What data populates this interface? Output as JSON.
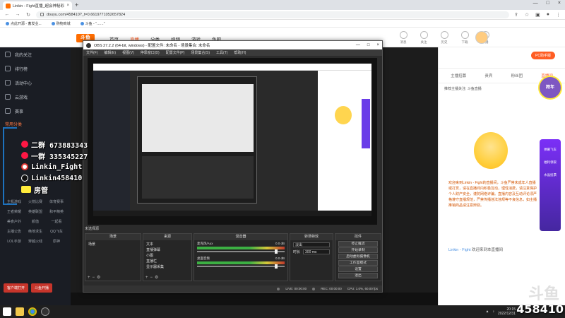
{
  "browser": {
    "tab_title": "Linkin - Fight直播_超会神秘彩三...",
    "tab_close": "×",
    "new_tab": "+",
    "url": "douyu.com/458410?_t=0.6619771052657824",
    "window_controls": [
      "—",
      "□",
      "×"
    ],
    "bookmarks": [
      "点此开源 - 蓄发业...",
      "购物商城",
      "斗鱼 - “……”"
    ]
  },
  "site": {
    "logo": "斗鱼",
    "nav": [
      "首页",
      "直播",
      "分类",
      "视频",
      "游戏",
      "鱼吧"
    ],
    "active_nav": "直播",
    "top_icons": [
      "消息",
      "关注",
      "历史",
      "下载",
      "开播"
    ],
    "pc_badge": "PC助手版"
  },
  "sidebar": {
    "items": [
      {
        "label": "我的关注",
        "icon": "heart-icon"
      },
      {
        "label": "排行榜",
        "icon": "trophy-icon"
      },
      {
        "label": "活动中心",
        "icon": "calendar-icon"
      },
      {
        "label": "云游戏",
        "icon": "cloud-icon"
      },
      {
        "label": "赛事",
        "icon": "cup-icon"
      }
    ],
    "section_title": "常用分类",
    "grid": [
      "主机游戏",
      "火箭比赛",
      "体育赛事",
      "王者荣耀",
      "英雄联盟",
      "和平精英",
      "美食户外",
      "颜值",
      "一起看",
      "主播公告",
      "绝地求生",
      "QQ飞车",
      "LOL手游",
      "穿越火线",
      "原神"
    ],
    "buttons": [
      "客户端打开",
      "斗鱼开播"
    ]
  },
  "obs": {
    "title": "OBS 27.2.2 (64-bit, windows) - 配置文件: 未命名 - 场景集合: 未命名",
    "menu": [
      "文件(F)",
      "编辑(E)",
      "视图(V)",
      "停靠窗口(D)",
      "配置文件(P)",
      "场景集合(S)",
      "工具(T)",
      "帮助(H)"
    ],
    "source_label": "未选择源",
    "scenes_header": "场景",
    "scene_name": "场景",
    "sources_header": "来源",
    "sources": [
      "文本",
      "直播弹幕",
      "小图",
      "直播栏",
      "显示器采集"
    ],
    "mixer_header": "混音器",
    "mixer": [
      {
        "name": "麦克风/Aux",
        "level": "0.0 dB"
      },
      {
        "name": "桌面音频",
        "level": "0.0 dB"
      }
    ],
    "transitions_header": "转场特效",
    "transition": "淡出",
    "duration_label": "时长",
    "duration": "300 ms",
    "controls_header": "控件",
    "controls": [
      "停止推流",
      "开始录制",
      "启动虚拟摄像机",
      "工作室模式",
      "设置",
      "退出"
    ],
    "status": {
      "live": "LIVE: 00:00:00",
      "rec": "REC: 00:00:00",
      "cpu": "CPU: 1.0%, 60.00 fps"
    },
    "preview_watermark": "458410"
  },
  "overlay": {
    "lines": [
      "二群 673883343",
      "一群 335345227",
      "Linkin_Fight",
      "Linkin458410",
      "房管"
    ]
  },
  "chat": {
    "tabs": [
      "主播招募",
      "贵宾",
      "粉丝团",
      "直播间"
    ],
    "active_tab": "直播间",
    "anchor_note": "推荐主播关注: 斗鱼直播",
    "welcome": "欢迎来到Linkin - Fight的直播间，斗鱼严禁未成年人直播或打赏，请在直播间内积极互动，理性消费，请注意保护个人财产安全，谨防网络诈骗。直播内容及互动评论须严格遵守直播规范，严禁传播违法违规等不良信息，如主播推销商品请注意辨别。",
    "event_badge": "跨年",
    "event_items": [
      "弹幕飞车",
      "福利领取",
      "水晶投票"
    ],
    "last_msg_user": "Linkin - Fight",
    "last_msg_text": "欢迎来到本直播间"
  },
  "watermark": "斗鱼",
  "room_number": "458410",
  "taskbar": {
    "clock_time": "20:15",
    "clock_date": "2022/12/31"
  }
}
